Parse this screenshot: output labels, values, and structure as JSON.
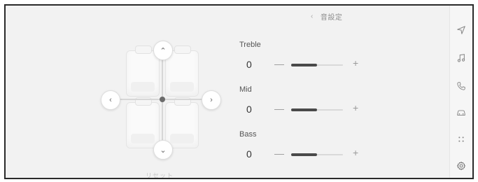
{
  "header": {
    "title": "音設定"
  },
  "eq": {
    "treble": {
      "label": "Treble",
      "value": "0",
      "minus": "—",
      "plus": "+",
      "level": 0.5
    },
    "mid": {
      "label": "Mid",
      "value": "0",
      "minus": "—",
      "plus": "+",
      "level": 0.5
    },
    "bass": {
      "label": "Bass",
      "value": "0",
      "minus": "—",
      "plus": "+",
      "level": 0.5
    }
  },
  "seat_map": {
    "reset_label": "リセット",
    "up_icon": "⌃",
    "down_icon": "⌄",
    "left_icon": "‹",
    "right_icon": "›"
  },
  "rail": {
    "icons": [
      "navigation-icon",
      "music-icon",
      "phone-icon",
      "car-icon",
      "apps-icon",
      "settings-icon"
    ],
    "active": "settings-icon"
  },
  "colors": {
    "background": "#f2f2f2",
    "accent": "#4a4a4a",
    "track": "#d9d9d9"
  }
}
